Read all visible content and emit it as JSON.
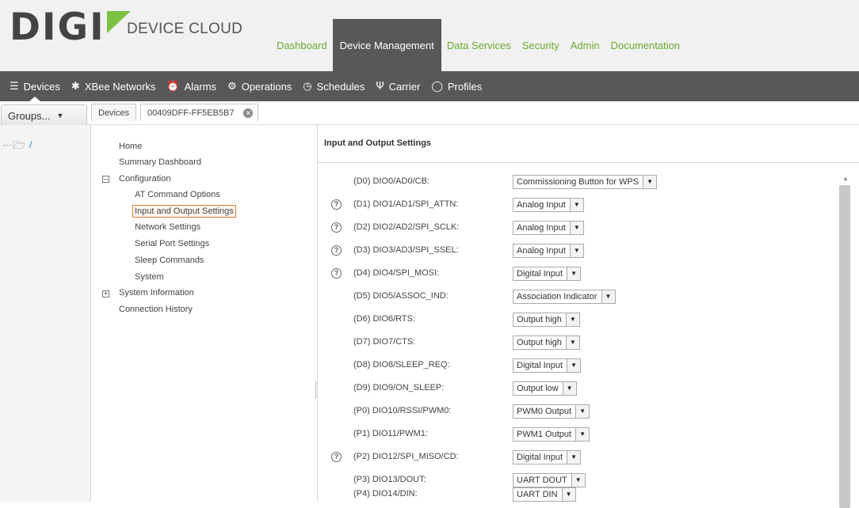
{
  "brand": {
    "word": "DIGI",
    "subtitle": "DEVICE CLOUD",
    "accent": "#7cc242"
  },
  "topnav": [
    {
      "label": "Dashboard",
      "active": false
    },
    {
      "label": "Device Management",
      "active": true
    },
    {
      "label": "Data Services",
      "active": false
    },
    {
      "label": "Security",
      "active": false
    },
    {
      "label": "Admin",
      "active": false
    },
    {
      "label": "Documentation",
      "active": false
    }
  ],
  "subnav": [
    {
      "label": "Devices",
      "icon": "devices-icon",
      "active": true
    },
    {
      "label": "XBee Networks",
      "icon": "xbee-icon",
      "active": false
    },
    {
      "label": "Alarms",
      "icon": "alarm-clock-icon",
      "active": false
    },
    {
      "label": "Operations",
      "icon": "gear-icon",
      "active": false
    },
    {
      "label": "Schedules",
      "icon": "clock-icon",
      "active": false
    },
    {
      "label": "Carrier",
      "icon": "antenna-icon",
      "active": false
    },
    {
      "label": "Profiles",
      "icon": "shield-icon",
      "active": false
    }
  ],
  "groups_button": "Groups...",
  "tabs": [
    "Devices",
    "00409DFF-FF5EB5B7"
  ],
  "groups_tree": {
    "root": "/"
  },
  "config_tree": {
    "home": "Home",
    "summary": "Summary Dashboard",
    "configuration": "Configuration",
    "config_children": [
      "AT Command Options",
      "Input and Output Settings",
      "Network Settings",
      "Serial Port Settings",
      "Sleep Commands",
      "System"
    ],
    "selected": "Input and Output Settings",
    "system_info": "System Information",
    "connection_history": "Connection History"
  },
  "settings": {
    "title": "Input and Output Settings",
    "rows": [
      {
        "label": "(D0) DIO0/AD0/CB:",
        "value": "Commissioning Button for WPS",
        "help": false
      },
      {
        "label": "(D1) DIO1/AD1/SPI_ATTN:",
        "value": "Analog Input",
        "help": true
      },
      {
        "label": "(D2) DIO2/AD2/SPI_SCLK:",
        "value": "Analog Input",
        "help": true
      },
      {
        "label": "(D3) DIO3/AD3/SPI_SSEL:",
        "value": "Analog Input",
        "help": true
      },
      {
        "label": "(D4) DIO4/SPI_MOSI:",
        "value": "Digital Input",
        "help": true
      },
      {
        "label": "(D5) DIO5/ASSOC_IND:",
        "value": "Association Indicator",
        "help": false
      },
      {
        "label": "(D6) DIO6/RTS:",
        "value": "Output high",
        "help": false
      },
      {
        "label": "(D7) DIO7/CTS:",
        "value": "Output high",
        "help": false
      },
      {
        "label": "(D8) DIO8/SLEEP_REQ:",
        "value": "Digital Input",
        "help": false
      },
      {
        "label": "(D9) DIO9/ON_SLEEP:",
        "value": "Output low",
        "help": false
      },
      {
        "label": "(P0) DIO10/RSSI/PWM0:",
        "value": "PWM0 Output",
        "help": false
      },
      {
        "label": "(P1) DIO11/PWM1:",
        "value": "PWM1 Output",
        "help": false
      },
      {
        "label": "(P2) DIO12/SPI_MISO/CD:",
        "value": "Digital Input",
        "help": true
      },
      {
        "label": "(P3) DIO13/DOUT:",
        "value": "UART DOUT",
        "help": false
      },
      {
        "label": "(P4) DIO14/DIN:",
        "value": "UART DIN",
        "help": false
      }
    ]
  }
}
